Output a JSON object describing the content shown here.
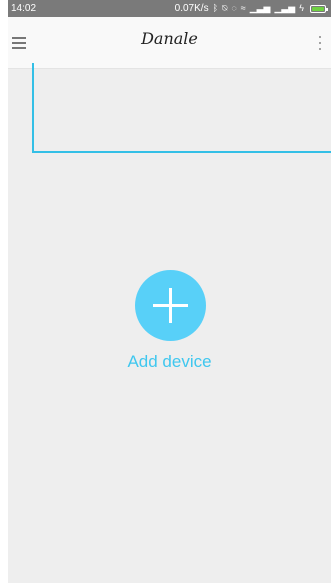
{
  "status_bar": {
    "time": "14:02",
    "net_speed": "0.07K/s",
    "icons": [
      "bluetooth-icon",
      "alarm-off-icon",
      "shield-icon",
      "wifi-icon",
      "signal-icon",
      "signal-icon",
      "charging-icon",
      "battery-icon"
    ],
    "battery_color": "#6fd142",
    "background": "#7a7a7a"
  },
  "app_bar": {
    "title": "Danale",
    "left_icon": "menu-icon",
    "right_icon": "more-vertical-icon"
  },
  "main": {
    "add_device_label": "Add device",
    "add_icon": "plus-icon",
    "accent_color": "#58d0f8",
    "guide_line_color": "#33bfe6"
  }
}
